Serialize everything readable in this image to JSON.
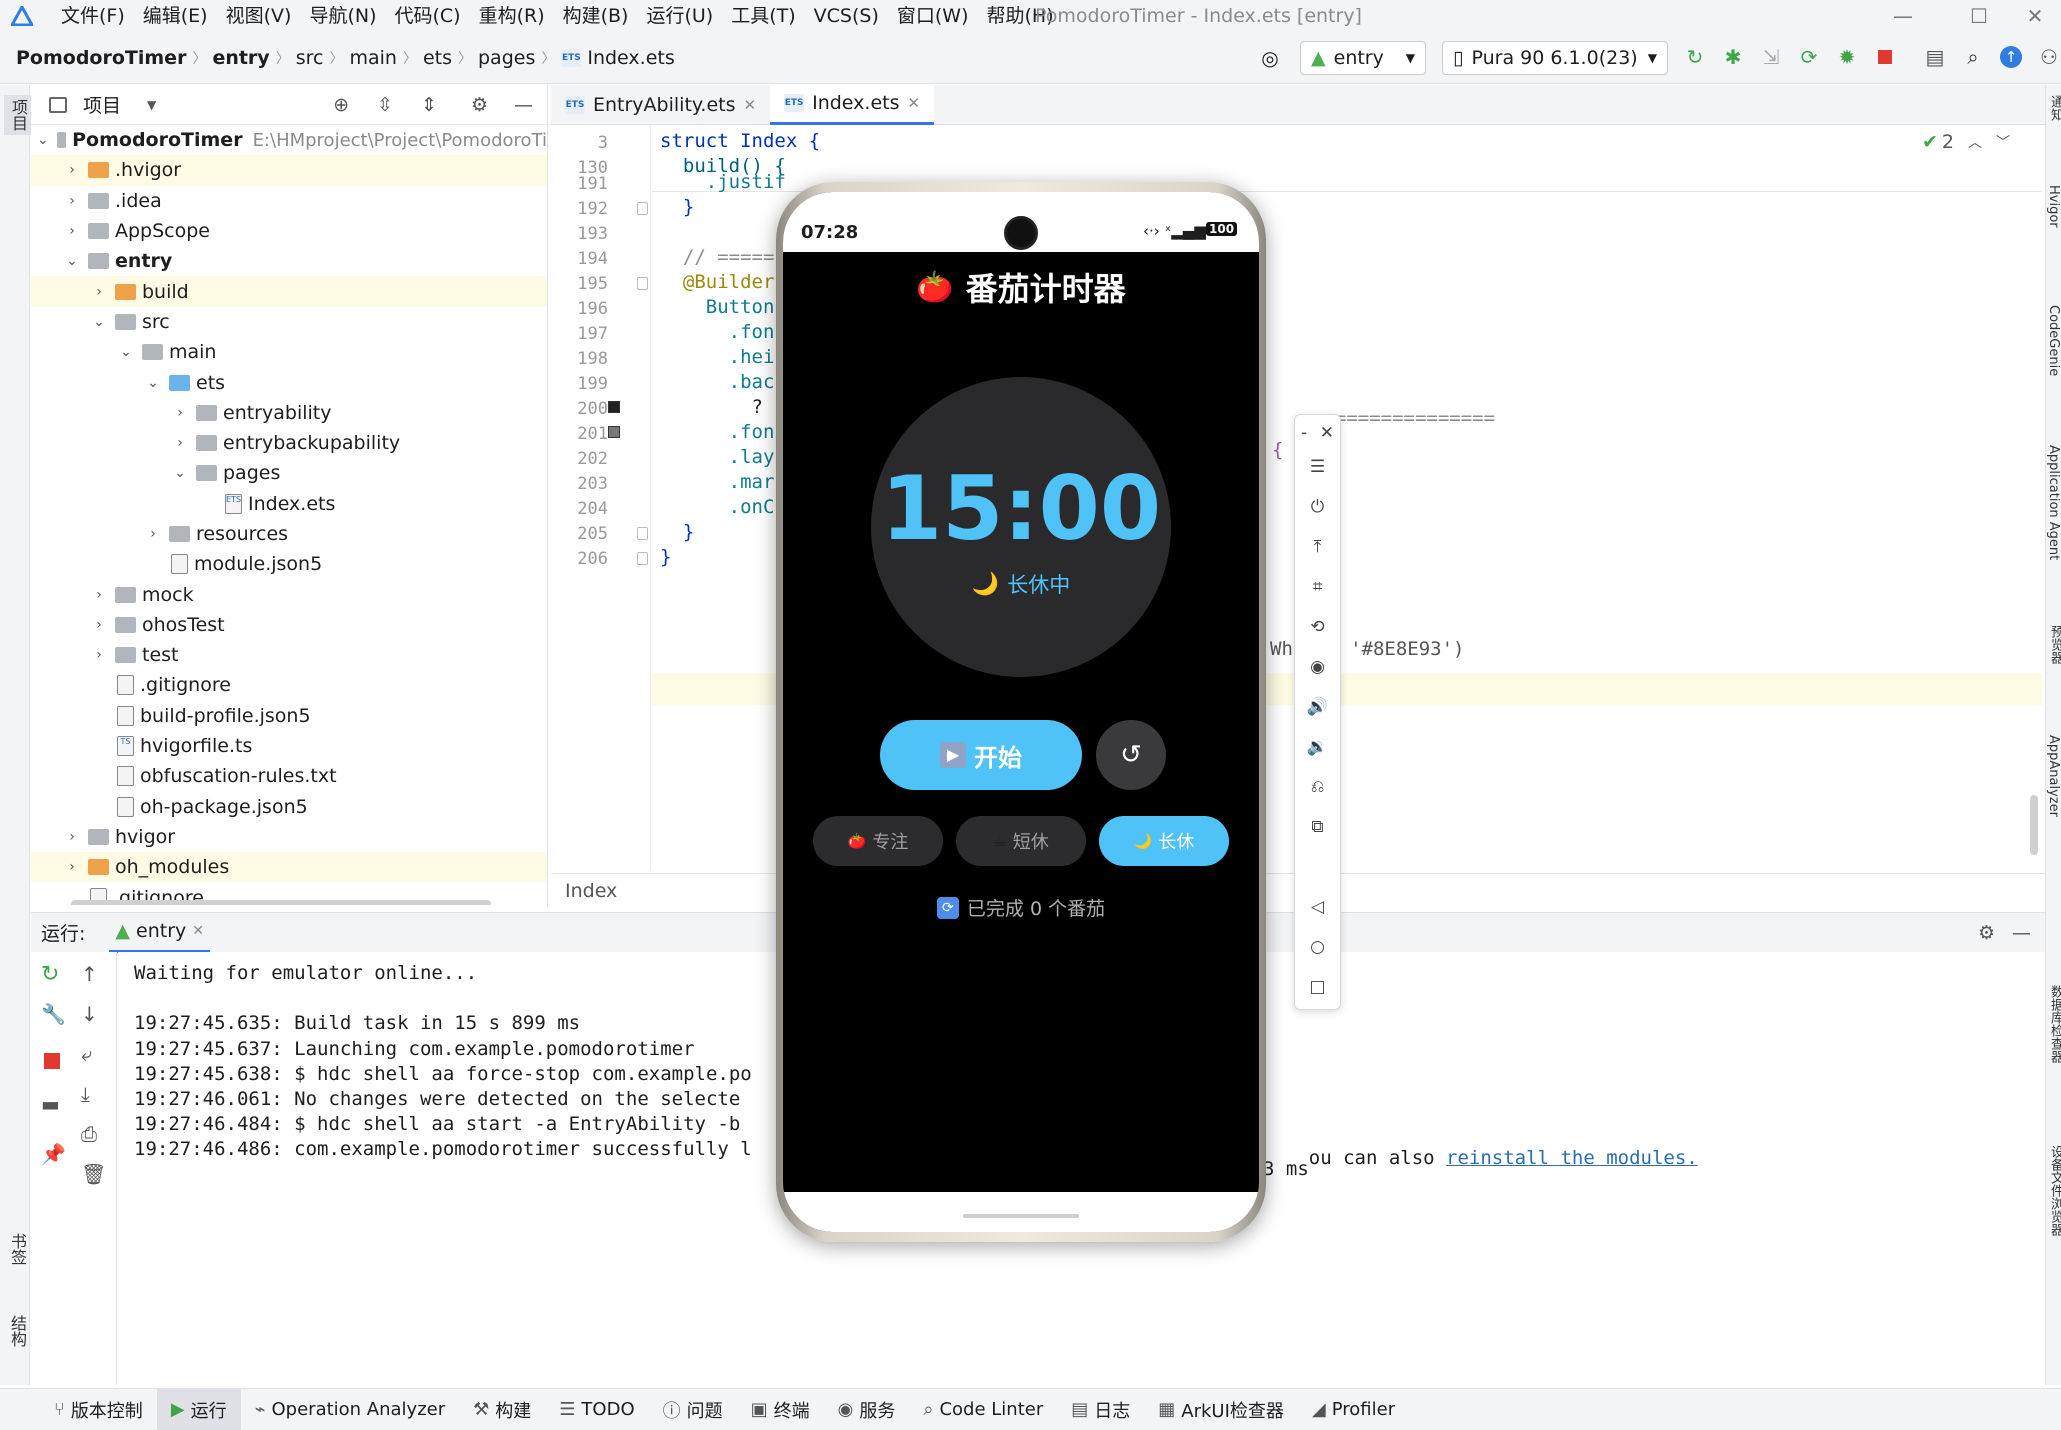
{
  "app": {
    "window_title": "PomodoroTimer - Index.ets [entry]"
  },
  "menu": [
    "文件(F)",
    "编辑(E)",
    "视图(V)",
    "导航(N)",
    "代码(C)",
    "重构(R)",
    "构建(B)",
    "运行(U)",
    "工具(T)",
    "VCS(S)",
    "窗口(W)",
    "帮助(H)"
  ],
  "breadcrumb": [
    "PomodoroTimer",
    "entry",
    "src",
    "main",
    "ets",
    "pages",
    "Index.ets"
  ],
  "toolbar": {
    "module_combo": "entry",
    "device_combo": "Pura 90 6.1.0(23)"
  },
  "project": {
    "header": "项目",
    "root_name": "PomodoroTimer",
    "root_path": "E:\\HMproject\\Project\\PomodoroTi",
    "items": [
      {
        "label": ".hvigor"
      },
      {
        "label": ".idea"
      },
      {
        "label": "AppScope"
      },
      {
        "label": "entry"
      },
      {
        "label": "build"
      },
      {
        "label": "src"
      },
      {
        "label": "main"
      },
      {
        "label": "ets"
      },
      {
        "label": "entryability"
      },
      {
        "label": "entrybackupability"
      },
      {
        "label": "pages"
      },
      {
        "label": "Index.ets"
      },
      {
        "label": "resources"
      },
      {
        "label": "module.json5"
      },
      {
        "label": "mock"
      },
      {
        "label": "ohosTest"
      },
      {
        "label": "test"
      },
      {
        "label": ".gitignore"
      },
      {
        "label": "build-profile.json5"
      },
      {
        "label": "hvigorfile.ts"
      },
      {
        "label": "obfuscation-rules.txt"
      },
      {
        "label": "oh-package.json5"
      },
      {
        "label": "hvigor"
      },
      {
        "label": "oh_modules"
      },
      {
        "label": ".gitignore"
      }
    ]
  },
  "editor": {
    "tabs": [
      "EntryAbility.ets",
      "Index.ets"
    ],
    "warnings": "2",
    "status_crumb": "Index",
    "lines": [
      {
        "num": "3",
        "text": "struct Index {"
      },
      {
        "num": "130",
        "text": "  build() {"
      },
      {
        "num": "191",
        "text": "    .justif"
      },
      {
        "num": "192",
        "text": "  }"
      },
      {
        "num": "193",
        "text": ""
      },
      {
        "num": "194",
        "text": "  // ====="
      },
      {
        "num": "195",
        "text": "  @Builder"
      },
      {
        "num": "196",
        "text": "    Button"
      },
      {
        "num": "197",
        "text": "      .fon"
      },
      {
        "num": "198",
        "text": "      .hei"
      },
      {
        "num": "199",
        "text": "      .bac"
      },
      {
        "num": "200",
        "text": "        ?"
      },
      {
        "num": "201",
        "text": "      .fon"
      },
      {
        "num": "202",
        "text": "      .lay"
      },
      {
        "num": "203",
        "text": "      .mar"
      },
      {
        "num": "204",
        "text": "      .onC"
      },
      {
        "num": "205",
        "text": "  }"
      },
      {
        "num": "206",
        "text": "}"
      }
    ],
    "right_fragments": {
      "line194": "================",
      "line195": "{",
      "line201": "Wh   : '#8E8E93')"
    }
  },
  "run": {
    "label": "运行:",
    "tab": "entry",
    "console": [
      "Waiting for emulator online...",
      "",
      "19:27:45.635: Build task in 15 s 899 ms",
      "19:27:45.637: Launching com.example.pomodorotimer",
      "19:27:45.638: $ hdc shell aa force-stop com.example.po",
      "19:27:46.061: No changes were detected on the selecte",
      "19:27:46.484: $ hdc shell aa start -a EntryAbility -b",
      "19:27:46.486: com.example.pomodorotimer successfully l"
    ],
    "line3_suffix": "ou can also ",
    "line3_link": "reinstall the modules.",
    "line4_suffix": "3 ms"
  },
  "bottom": [
    "版本控制",
    "运行",
    "Operation Analyzer",
    "构建",
    "TODO",
    "问题",
    "终端",
    "服务",
    "Code Linter",
    "日志",
    "ArkUI检查器",
    "Profiler"
  ],
  "left_strip": {
    "top": "项目",
    "bookmark": "书签",
    "structure": "结构"
  },
  "right_strip": [
    "通知",
    "Hvigor",
    "CodeGenie",
    "Application Agent",
    "预览器",
    "AppAnalyzer",
    "数据库检查器",
    "设备文件浏览器"
  ],
  "phone": {
    "time": "07:28",
    "battery": "100",
    "app_title": "番茄计时器",
    "timer": "15:00",
    "mode_status": "长休中",
    "start_label": "开始",
    "modes": [
      {
        "label": "专注",
        "icon": "🍅",
        "active": false
      },
      {
        "label": "短休",
        "icon": "☕",
        "active": false
      },
      {
        "label": "长休",
        "icon": "🌙",
        "active": true
      }
    ],
    "completed": "已完成 0 个番茄",
    "accent": "#4fc3f7",
    "bg": "#000000",
    "chip_bg": "#2c2c2e"
  }
}
